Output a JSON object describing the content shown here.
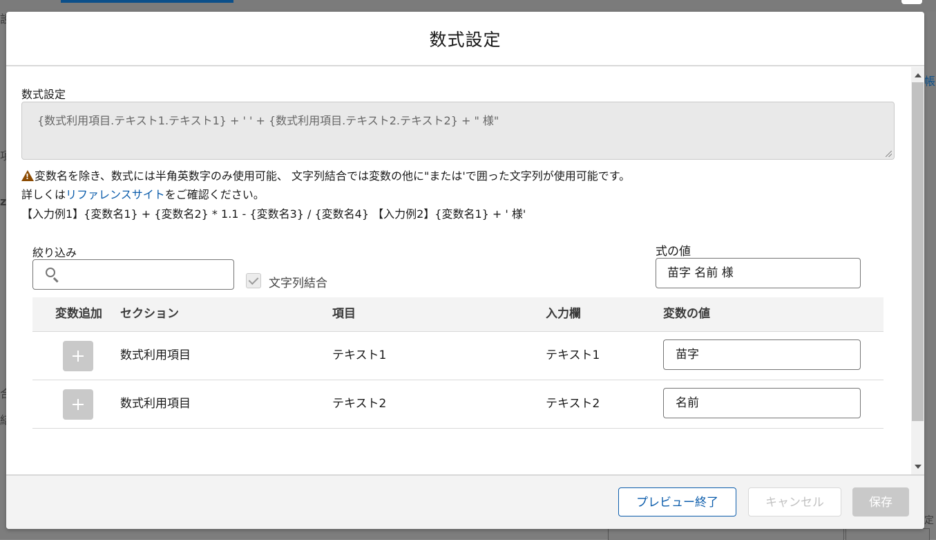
{
  "background": {
    "left_fragments": [
      "設",
      "項",
      "z",
      "合",
      "結"
    ],
    "right_fragments": [
      "帳",
      "定"
    ]
  },
  "modal": {
    "title": "数式設定",
    "formula": {
      "label": "数式設定",
      "value": "{数式利用項目.テキスト1.テキスト1}  + ' ' + {数式利用項目.テキスト2.テキスト2} + \" 様\""
    },
    "notes": {
      "line1": "変数名を除き、数式には半角英数字のみ使用可能、 文字列結合では変数の他に\"または'で囲った文字列が使用可能です。",
      "line2_prefix": "詳しくは",
      "line2_link": "リファレンスサイト",
      "line2_suffix": "をご確認ください。",
      "line3": "【入力例1】{変数名1} + {変数名2} * 1.1 - {変数名3} / {変数名4} 【入力例2】{変数名1} + ' 様'"
    },
    "filter": {
      "label": "絞り込み",
      "placeholder": "",
      "value": ""
    },
    "string_concat": {
      "label": "文字列結合",
      "checked": true
    },
    "formula_value": {
      "label": "式の値",
      "value": "苗字 名前 様"
    },
    "table": {
      "headers": [
        "変数追加",
        "セクション",
        "項目",
        "入力欄",
        "変数の値"
      ],
      "rows": [
        {
          "section": "数式利用項目",
          "item": "テキスト1",
          "input": "テキスト1",
          "value": "苗字"
        },
        {
          "section": "数式利用項目",
          "item": "テキスト2",
          "input": "テキスト2",
          "value": "名前"
        }
      ]
    },
    "footer": {
      "preview_end_label": "プレビュー終了",
      "cancel_label": "キャンセル",
      "save_label": "保存"
    }
  },
  "colors": {
    "link": "#0b5cab",
    "warning": "#8c4b02",
    "disabled": "#c9c9c9"
  }
}
